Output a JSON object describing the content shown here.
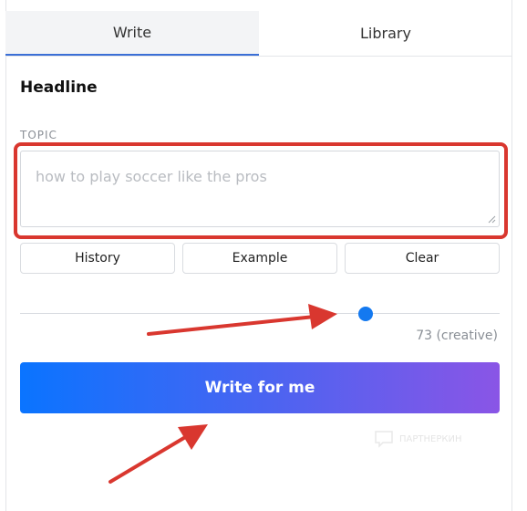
{
  "tabs": [
    {
      "label": "Write",
      "active": true
    },
    {
      "label": "Library",
      "active": false
    }
  ],
  "section_title": "Headline",
  "topic": {
    "label": "TOPIC",
    "placeholder": "how to play soccer like the pros",
    "value": ""
  },
  "actions": {
    "history": "History",
    "example": "Example",
    "clear": "Clear"
  },
  "creativity": {
    "value": 73,
    "text": "73 (creative)",
    "fraction": 0.72
  },
  "write_button": "Write for me",
  "watermark": "ПАРТНЕРКИН",
  "colors": {
    "accent": "#1479f0",
    "annotation": "#d9372f",
    "gradient_start": "#0a74ff",
    "gradient_end": "#8a55e6"
  }
}
